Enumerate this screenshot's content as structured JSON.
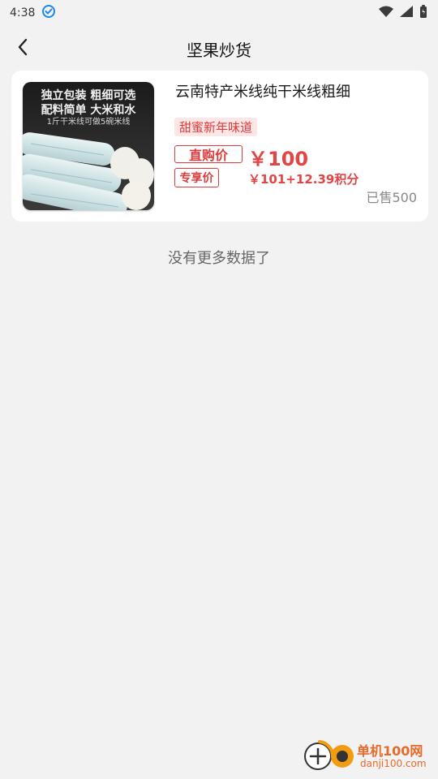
{
  "status": {
    "time": "4:38"
  },
  "header": {
    "title": "坚果炒货"
  },
  "product": {
    "title": "云南特产米线纯干米线粗细",
    "tag": "甜蜜新年味道",
    "direct_label": "直购价",
    "direct_price": "￥100",
    "exclusive_label": "专享价",
    "exclusive_price": "￥101+12.39积分",
    "sold": "已售500",
    "image_text": {
      "line1": "独立包装 粗细可选",
      "line2": "配料简单 大米和水",
      "line3": "1斤干米线可做5碗米线"
    }
  },
  "list": {
    "end_text": "没有更多数据了"
  },
  "watermark": {
    "name": "单机100网",
    "domain": "danji100.com"
  },
  "colors": {
    "accent_red": "#e24545",
    "tag_bg": "#fde6e6",
    "page_bg": "#f2f2f2"
  }
}
